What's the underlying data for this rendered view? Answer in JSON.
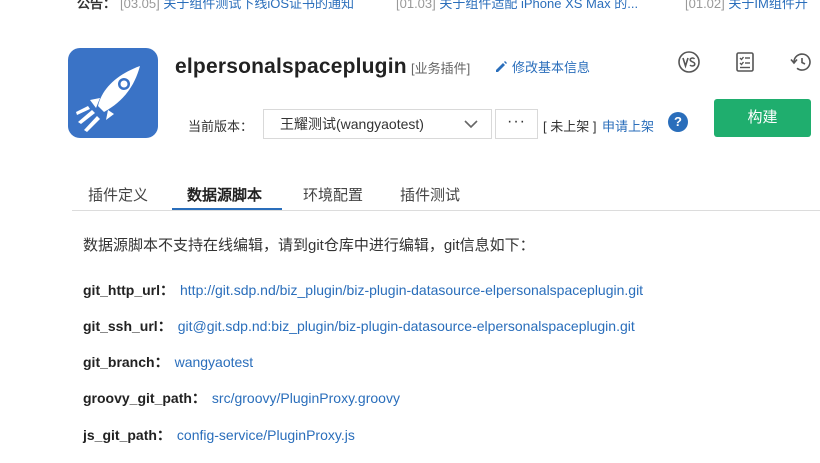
{
  "notice": {
    "label": "公告：",
    "items": [
      {
        "date": "[03.05]",
        "title": "关于组件测试下线iOS证书的通知"
      },
      {
        "date": "[01.03]",
        "title": "关于组件适配 iPhone XS Max 的..."
      },
      {
        "date": "[01.02]",
        "title": "关于IM组件升"
      }
    ]
  },
  "plugin": {
    "name": "elpersonalspaceplugin",
    "tag": "[业务插件]",
    "edit_label": "修改基本信息"
  },
  "version": {
    "label": "当前版本：",
    "selected": "王耀测试(wangyaotest)",
    "more_label": "···",
    "status": "[ 未上架 ]",
    "apply_label": "申请上架",
    "help_label": "?"
  },
  "build_label": "构建",
  "tabs": [
    {
      "label": "插件定义"
    },
    {
      "label": "数据源脚本"
    },
    {
      "label": "环境配置"
    },
    {
      "label": "插件测试"
    }
  ],
  "content": {
    "intro": "数据源脚本不支持在线编辑，请到git仓库中进行编辑，git信息如下：",
    "rows": [
      {
        "key": "git_http_url：",
        "value": "http://git.sdp.nd/biz_plugin/biz-plugin-datasource-elpersonalspaceplugin.git"
      },
      {
        "key": "git_ssh_url：",
        "value": "git@git.sdp.nd:biz_plugin/biz-plugin-datasource-elpersonalspaceplugin.git"
      },
      {
        "key": "git_branch：",
        "value": "wangyaotest"
      },
      {
        "key": "groovy_git_path：",
        "value": "src/groovy/PluginProxy.groovy"
      },
      {
        "key": "js_git_path：",
        "value": "config-service/PluginProxy.js"
      }
    ]
  },
  "icons": {
    "logo": "rocket-logo",
    "edit": "pencil-icon",
    "top_right": [
      "vs-compare-icon",
      "checklist-icon",
      "history-icon"
    ],
    "select": "chevron-down-icon"
  },
  "colors": {
    "accent": "#2a6ebb",
    "build": "#1fae6e",
    "logo_bg": "#3a73c6"
  }
}
